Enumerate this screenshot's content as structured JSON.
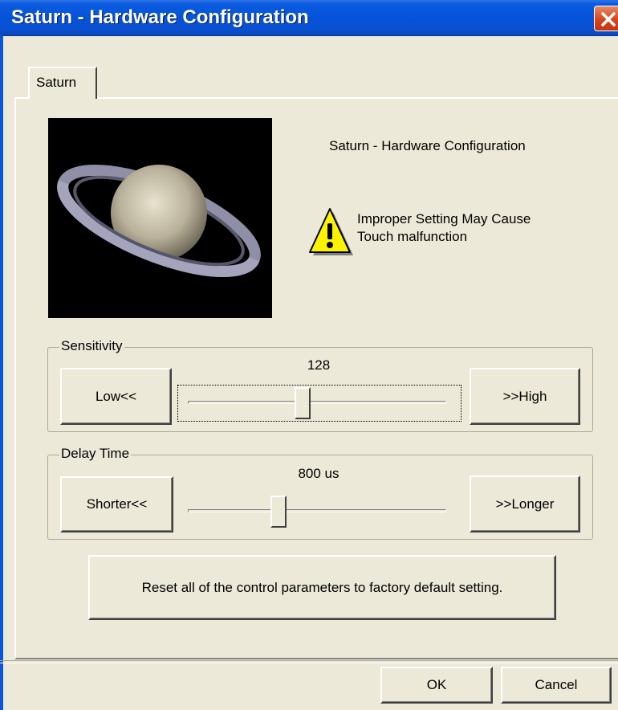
{
  "window": {
    "title": "Saturn - Hardware Configuration",
    "title_bar_color": "#0553d8",
    "close_button_icon": "close-icon"
  },
  "tab": {
    "label": "Saturn"
  },
  "header": {
    "heading": "Saturn - Hardware Configuration",
    "warning_icon": "warning-icon",
    "warning_line1": "Improper Setting May Cause",
    "warning_line2": "Touch malfunction"
  },
  "sensitivity": {
    "group_label": "Sensitivity",
    "value": "128",
    "decrease_label": "Low<<",
    "increase_label": ">>High",
    "slider_fraction": 0.44
  },
  "delay": {
    "group_label": "Delay Time",
    "value": "800 us",
    "decrease_label": "Shorter<<",
    "increase_label": ">>Longer",
    "slider_fraction": 0.34
  },
  "reset_button": {
    "label": "Reset all of the control parameters to factory default setting."
  },
  "footer": {
    "ok_label": "OK",
    "cancel_label": "Cancel"
  }
}
